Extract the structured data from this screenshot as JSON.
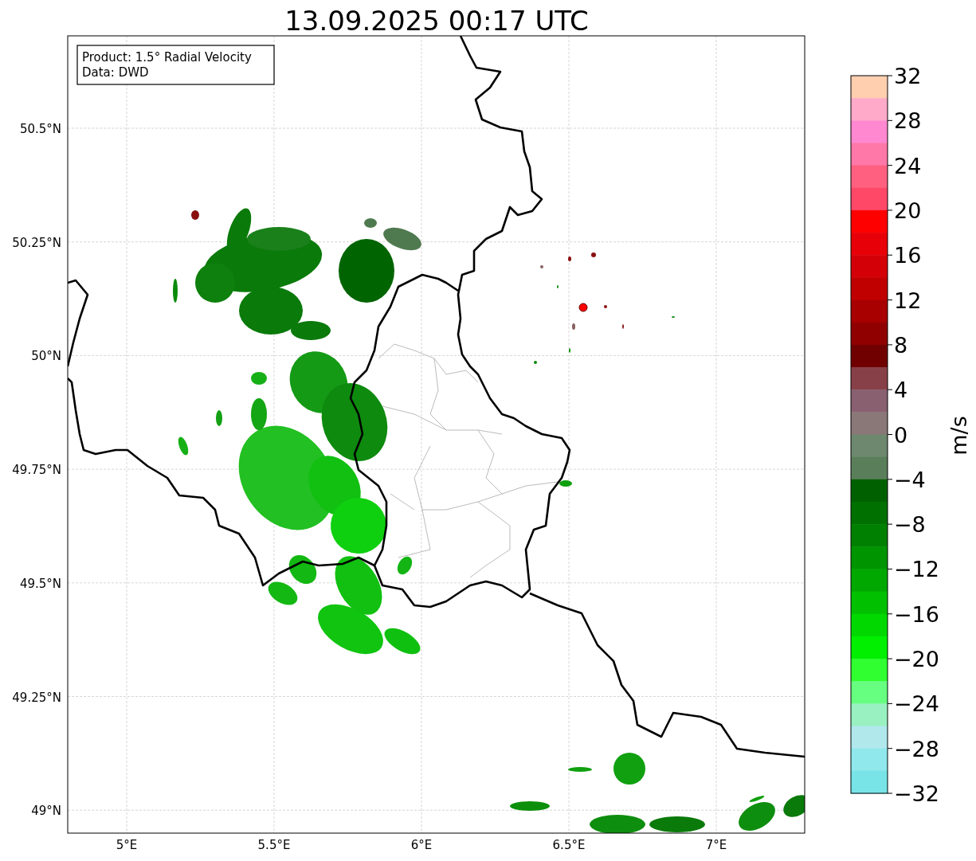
{
  "title": "13.09.2025 00:17 UTC",
  "map": {
    "info_box": [
      "Product: 1.5° Radial Velocity",
      "Data: DWD"
    ],
    "y_ticks": [
      "50.5°N",
      "50.25°N",
      "50°N",
      "49.75°N",
      "49.5°N",
      "49.25°N",
      "49°N"
    ],
    "x_ticks": [
      "5°E",
      "5.5°E",
      "6°E",
      "6.5°E",
      "7°E"
    ]
  },
  "colorbar": {
    "label": "m/s",
    "ticks": [
      "32",
      "28",
      "24",
      "20",
      "16",
      "12",
      "8",
      "4",
      "0",
      "−4",
      "−8",
      "−12",
      "−16",
      "−20",
      "−24",
      "−28",
      "−32"
    ],
    "segments": [
      {
        "color": "#ffcfb0"
      },
      {
        "color": "#ffaac8"
      },
      {
        "color": "#ff88d0"
      },
      {
        "color": "#ff78a8"
      },
      {
        "color": "#ff6080"
      },
      {
        "color": "#ff4868"
      },
      {
        "color": "#ff0000"
      },
      {
        "color": "#e80008"
      },
      {
        "color": "#d40008"
      },
      {
        "color": "#c00000"
      },
      {
        "color": "#a80000"
      },
      {
        "color": "#900000"
      },
      {
        "color": "#700000"
      },
      {
        "color": "#884048"
      },
      {
        "color": "#886070"
      },
      {
        "color": "#8a7878"
      },
      {
        "color": "#6e8870"
      },
      {
        "color": "#5a7e5a"
      },
      {
        "color": "#006000"
      },
      {
        "color": "#007000"
      },
      {
        "color": "#008000"
      },
      {
        "color": "#009400"
      },
      {
        "color": "#00a800"
      },
      {
        "color": "#00c000"
      },
      {
        "color": "#00d800"
      },
      {
        "color": "#00f000"
      },
      {
        "color": "#30ff30"
      },
      {
        "color": "#66ff80"
      },
      {
        "color": "#99f0c0"
      },
      {
        "color": "#b0e8ec"
      },
      {
        "color": "#90e8ec"
      },
      {
        "color": "#78e4e8"
      }
    ]
  }
}
